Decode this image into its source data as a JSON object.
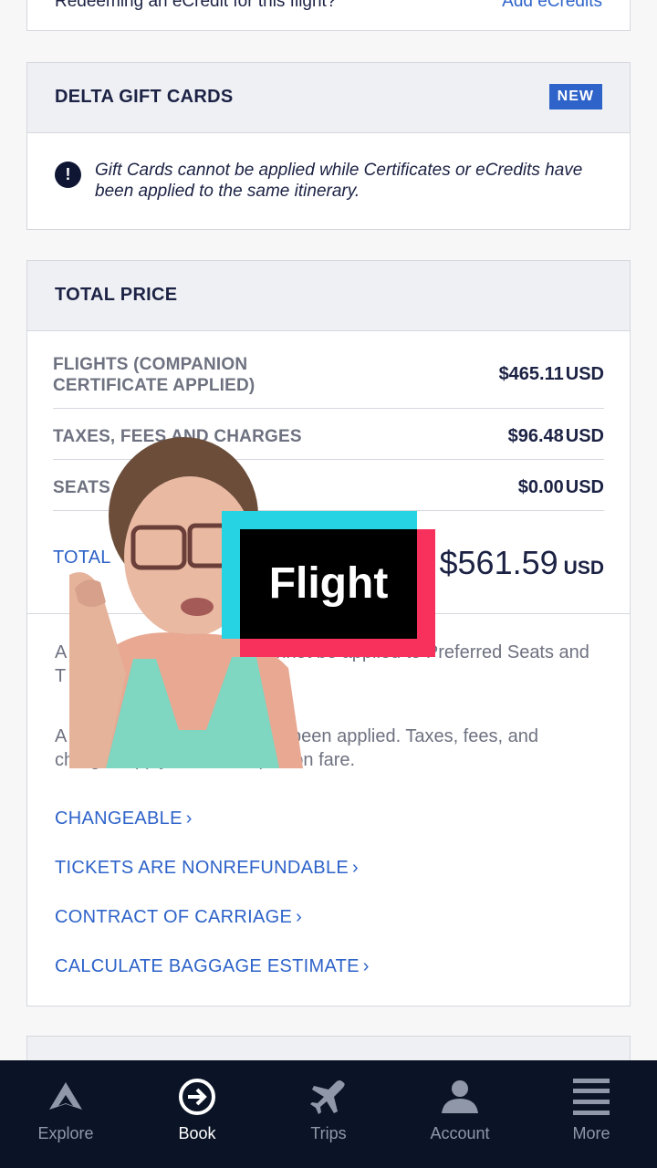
{
  "ecredit": {
    "text": "Redeeming an eCredit for this flight?",
    "link": "Add eCredits"
  },
  "gift_cards": {
    "title": "DELTA GIFT CARDS",
    "badge": "NEW",
    "warning": "Gift Cards cannot be applied while Certificates or eCredits have been applied to the same itinerary."
  },
  "total_price": {
    "title": "TOTAL PRICE",
    "rows": [
      {
        "label": "FLIGHTS (COMPANION CERTIFICATE APPLIED)",
        "amount": "$465.11",
        "currency": "USD"
      },
      {
        "label": "TAXES, FEES AND CHARGES",
        "amount": "$96.48",
        "currency": "USD"
      },
      {
        "label": "SEATS",
        "amount": "$0.00",
        "currency": "USD"
      }
    ],
    "total": {
      "label": "TOTAL",
      "amount": "$561.59",
      "currency": "USD"
    },
    "notes": [
      "A Companion Certificate cannot be applied to Preferred Seats and T",
      "A Companion Certificate has been applied. Taxes, fees, and charges apply to the companion fare."
    ],
    "links": [
      "CHANGEABLE",
      "TICKETS ARE NONREFUNDABLE",
      "CONTRACT OF CARRIAGE",
      "CALCULATE BAGGAGE ESTIMATE"
    ],
    "chevron": "›"
  },
  "sticker": {
    "caption": "Flight"
  },
  "nav": {
    "items": [
      {
        "label": "Explore",
        "icon": "delta-widget-icon",
        "active": false
      },
      {
        "label": "Book",
        "icon": "book-arrow-icon",
        "active": true
      },
      {
        "label": "Trips",
        "icon": "plane-icon",
        "active": false
      },
      {
        "label": "Account",
        "icon": "person-icon",
        "active": false
      },
      {
        "label": "More",
        "icon": "menu-icon",
        "active": false
      }
    ]
  },
  "colors": {
    "link": "#2e63c9",
    "nav_bg": "#0b1426",
    "sticker_cyan": "#25d3e3",
    "sticker_red": "#f7315b"
  }
}
